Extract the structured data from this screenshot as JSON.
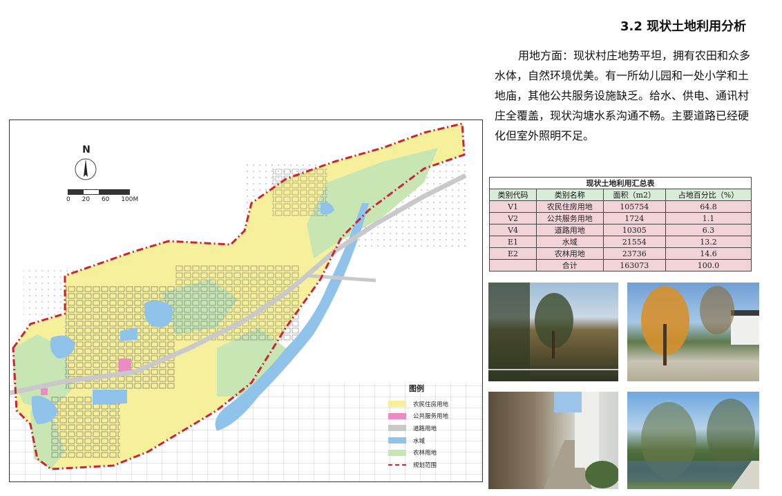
{
  "title": "3.2   现状土地利用分析",
  "description": "用地方面：现状村庄地势平坦，拥有农田和众多水体，自然环境优美。有一所幼儿园和一处小学和土地庙，其他公共服务设施缺乏。给水、供电、通讯村庄全覆盖，现状沟塘水系沟通不畅。主要道路已经硬化但室外照明不足。",
  "map": {
    "north_label": "N",
    "scale_labels": [
      "0",
      "20",
      "60",
      "100M"
    ],
    "legend": {
      "title": "图例",
      "items": [
        {
          "label": "农民住房用地",
          "color": "#f6f09c"
        },
        {
          "label": "公共服务用地",
          "color": "#ec8cc4"
        },
        {
          "label": "道路用地",
          "color": "#c9c9c9"
        },
        {
          "label": "水域",
          "color": "#8fc3ea"
        },
        {
          "label": "农林用地",
          "color": "#c8e6b4"
        },
        {
          "label": "规划范围",
          "color": "#cc2233"
        }
      ]
    }
  },
  "table": {
    "caption": "现状土地利用汇总表",
    "headers": [
      "类别代码",
      "类别名称",
      "面积（m2）",
      "占地百分比（%）"
    ],
    "rows": [
      [
        "V1",
        "农民住房用地",
        "105754",
        "64.8"
      ],
      [
        "V2",
        "公共服务用地",
        "1724",
        "1.1"
      ],
      [
        "V4",
        "道路用地",
        "10305",
        "6.3"
      ],
      [
        "E1",
        "水域",
        "21554",
        "13.2"
      ],
      [
        "E2",
        "农林用地",
        "23736",
        "14.6"
      ],
      [
        "",
        "合计",
        "163073",
        "100.0"
      ]
    ]
  }
}
